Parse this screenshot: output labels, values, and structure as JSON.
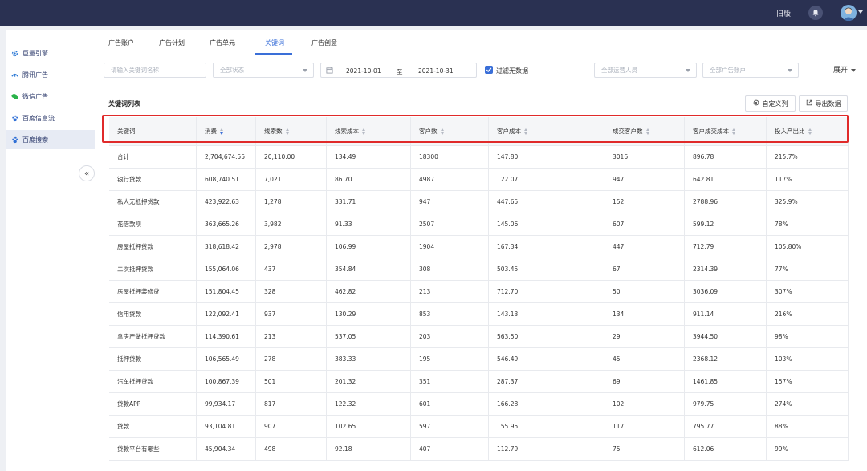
{
  "header": {
    "old_version": "旧版"
  },
  "sidebar": {
    "items": [
      {
        "label": "巨量引擎",
        "icon": "gear-icon"
      },
      {
        "label": "腾讯广告",
        "icon": "tencent-icon"
      },
      {
        "label": "微信广告",
        "icon": "wechat-icon"
      },
      {
        "label": "百度信息流",
        "icon": "baidu-paw-icon"
      },
      {
        "label": "百度搜索",
        "icon": "baidu-paw-icon",
        "active": true
      }
    ],
    "collapse_label": "«"
  },
  "tabs": [
    {
      "label": "广告账户"
    },
    {
      "label": "广告计划"
    },
    {
      "label": "广告单元"
    },
    {
      "label": "关键词",
      "active": true
    },
    {
      "label": "广告创意"
    }
  ],
  "filters": {
    "keyword_placeholder": "请输入关键词名称",
    "status": "全部状态",
    "date_start": "2021-10-01",
    "date_sep": "至",
    "date_end": "2021-10-31",
    "filter_no_data": "过滤无数据",
    "operator": "全部运营人员",
    "account": "全部广告账户",
    "expand": "展开"
  },
  "list": {
    "title": "关键词列表",
    "custom_columns": "自定义列",
    "export": "导出数据"
  },
  "table": {
    "columns": [
      "关键词",
      "消费",
      "线索数",
      "线索成本",
      "客户数",
      "客户成本",
      "成交客户数",
      "客户成交成本",
      "投入产出比"
    ],
    "sorted_column": "消费",
    "rows": [
      [
        "合计",
        "2,704,674.55",
        "20,110.00",
        "134.49",
        "18300",
        "147.80",
        "3016",
        "896.78",
        "215.7%"
      ],
      [
        "银行贷款",
        "608,740.51",
        "7,021",
        "86.70",
        "4987",
        "122.07",
        "947",
        "642.81",
        "117%"
      ],
      [
        "私人无抵押贷款",
        "423,922.63",
        "1,278",
        "331.71",
        "947",
        "447.65",
        "152",
        "2788.96",
        "325.9%"
      ],
      [
        "花借款呗",
        "363,665.26",
        "3,982",
        "91.33",
        "2507",
        "145.06",
        "607",
        "599.12",
        "78%"
      ],
      [
        "房屋抵押贷款",
        "318,618.42",
        "2,978",
        "106.99",
        "1904",
        "167.34",
        "447",
        "712.79",
        "105.80%"
      ],
      [
        "二次抵押贷款",
        "155,064.06",
        "437",
        "354.84",
        "308",
        "503.45",
        "67",
        "2314.39",
        "77%"
      ],
      [
        "房屋抵押装修贷",
        "151,804.45",
        "328",
        "462.82",
        "213",
        "712.70",
        "50",
        "3036.09",
        "307%"
      ],
      [
        "信用贷款",
        "122,092.41",
        "937",
        "130.29",
        "853",
        "143.13",
        "134",
        "911.14",
        "216%"
      ],
      [
        "拿房产做抵押贷款",
        "114,390.61",
        "213",
        "537.05",
        "203",
        "563.50",
        "29",
        "3944.50",
        "98%"
      ],
      [
        "抵押贷款",
        "106,565.49",
        "278",
        "383.33",
        "195",
        "546.49",
        "45",
        "2368.12",
        "103%"
      ],
      [
        "汽车抵押贷款",
        "100,867.39",
        "501",
        "201.32",
        "351",
        "287.37",
        "69",
        "1461.85",
        "157%"
      ],
      [
        "贷款APP",
        "99,934.17",
        "817",
        "122.32",
        "601",
        "166.28",
        "102",
        "979.75",
        "274%"
      ],
      [
        "贷款",
        "93,104.81",
        "907",
        "102.65",
        "597",
        "155.95",
        "117",
        "795.77",
        "88%"
      ],
      [
        "贷款平台有哪些",
        "45,904.34",
        "498",
        "92.18",
        "407",
        "112.79",
        "75",
        "612.06",
        "99%"
      ]
    ]
  },
  "colors": {
    "topbar": "#2a3152",
    "accent": "#3a6fd8",
    "highlight_box": "#e02a2a"
  }
}
